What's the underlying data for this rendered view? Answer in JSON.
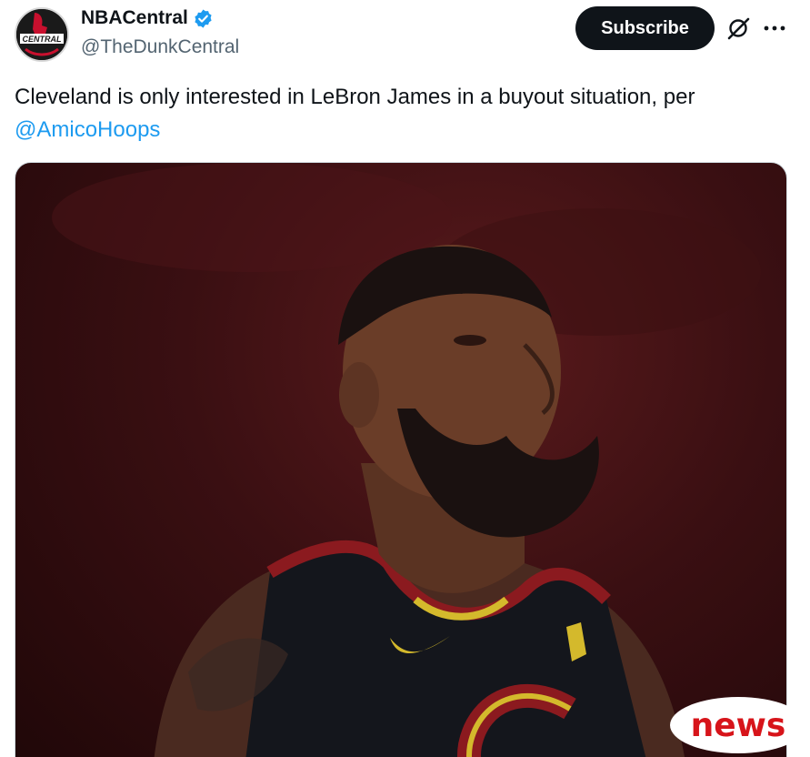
{
  "account": {
    "display_name": "NBACentral",
    "handle": "@TheDunkCentral",
    "avatar_text": "CENTRAL",
    "verified": true
  },
  "header": {
    "subscribe_label": "Subscribe",
    "grok_icon": "grok-slash-icon",
    "more_icon": "more-dots-icon"
  },
  "tweet": {
    "text": "Cleveland is only interested in LeBron James in a buyout situation, per",
    "mention": "@AmicoHoops"
  },
  "media": {
    "alt": "Basketball player in a Cleveland jersey looking up"
  },
  "overlay": {
    "news_label": "news"
  },
  "colors": {
    "accent": "#1d9bf0",
    "button_bg": "#0f1419",
    "text": "#0f1419",
    "secondary": "#536471",
    "news_red": "#d7141a"
  }
}
